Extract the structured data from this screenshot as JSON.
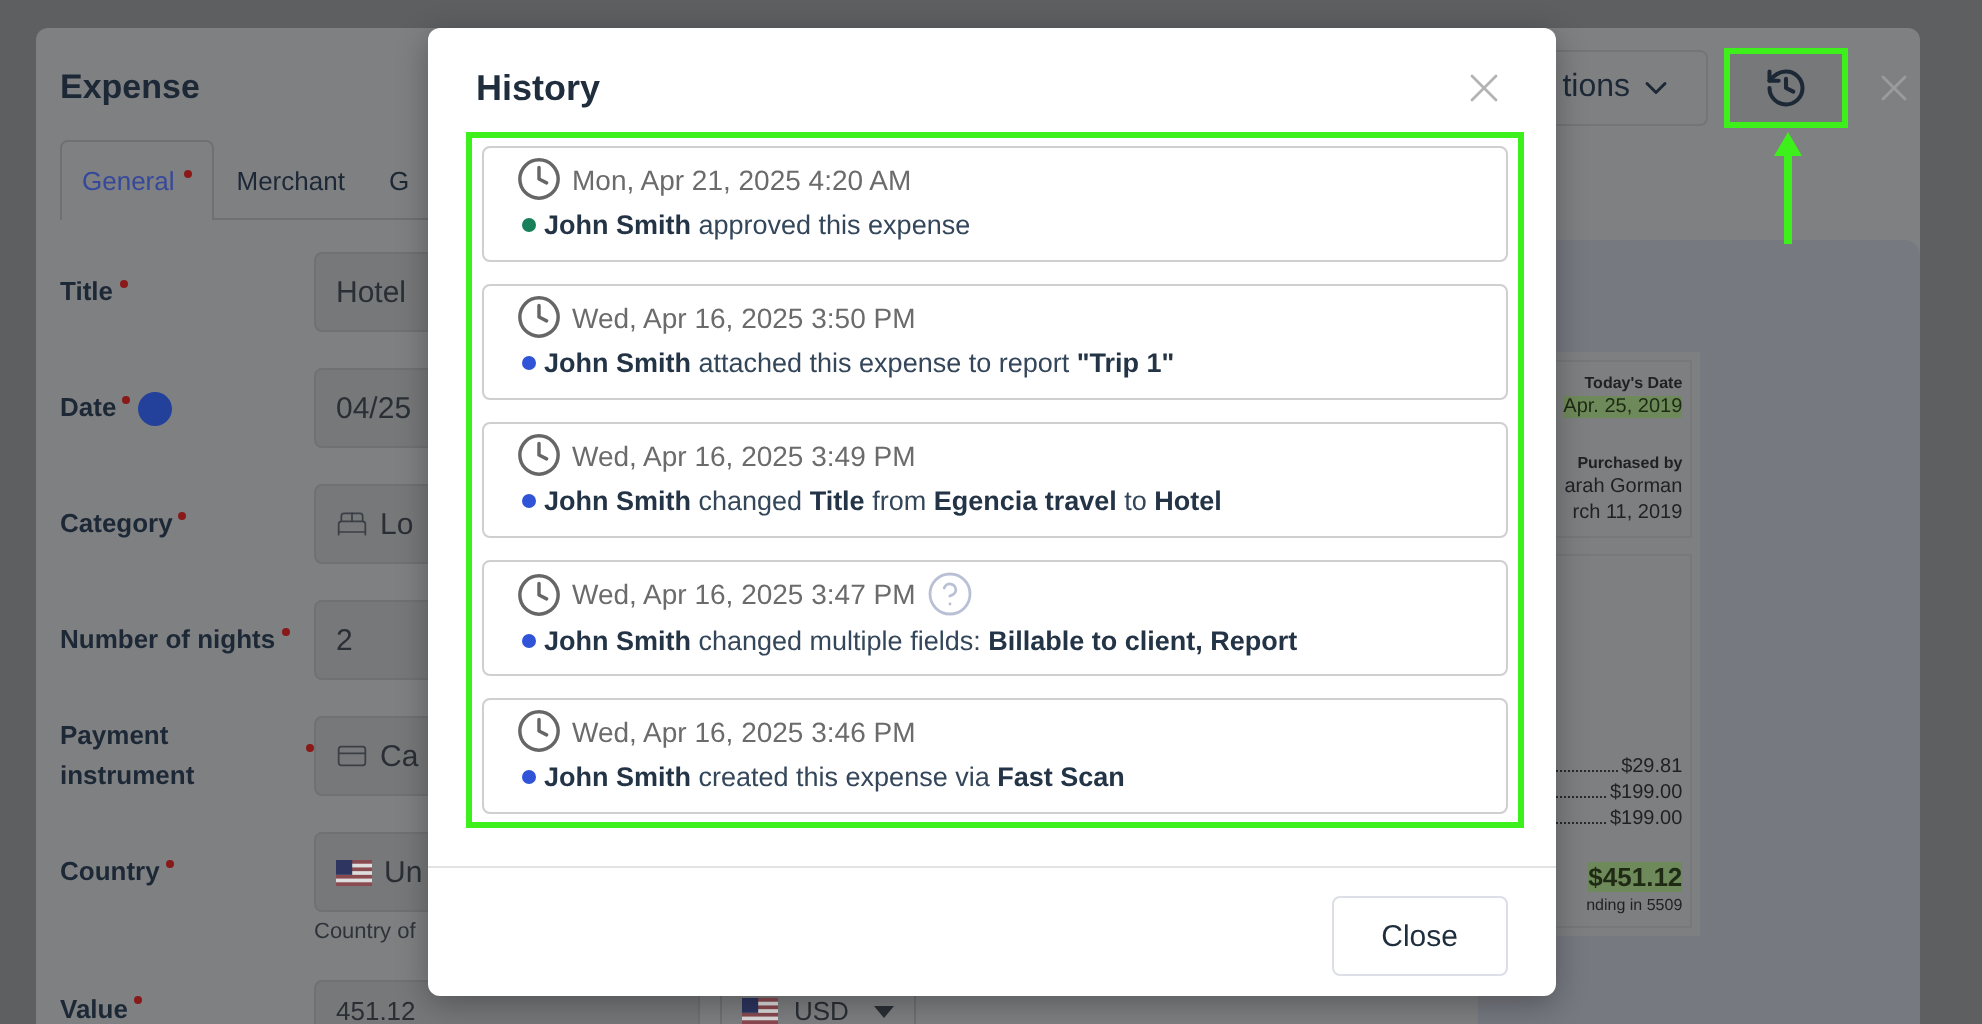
{
  "page": {
    "title": "Expense",
    "tabs": [
      {
        "label": "General",
        "required": true,
        "selected": true
      },
      {
        "label": "Merchant",
        "required": false,
        "selected": false
      },
      {
        "label": "G",
        "required": false,
        "selected": false
      }
    ],
    "options_button": {
      "label": "tions"
    },
    "fields": [
      {
        "label": "Title",
        "required": true,
        "help": false,
        "value": "Hotel",
        "kind": "text"
      },
      {
        "label": "Date",
        "required": true,
        "help": true,
        "value": "04/25",
        "kind": "text"
      },
      {
        "label": "Category",
        "required": true,
        "help": false,
        "value": "Lo",
        "kind": "category"
      },
      {
        "label": "Number of nights",
        "required": true,
        "help": false,
        "value": "2",
        "kind": "text"
      },
      {
        "label": "Payment instrument",
        "required": true,
        "help": false,
        "value": "Ca",
        "kind": "payment"
      },
      {
        "label": "Country",
        "required": true,
        "help": false,
        "value": "Un",
        "kind": "country",
        "hint": "Country of"
      },
      {
        "label": "Value",
        "required": true,
        "help": false,
        "value": "451.12",
        "kind": "amount",
        "currency": "USD"
      }
    ],
    "receipt": {
      "date_label": "Today's Date",
      "date": "Apr. 25, 2019",
      "purchased_label": "Purchased by",
      "purchaser": "arah Gorman",
      "purchase_date": "rch 11, 2019",
      "amounts": [
        "$29.81",
        "$199.00",
        "$199.00"
      ],
      "total": "$451.12",
      "card_note": "nding in 5509"
    }
  },
  "history": {
    "title": "History",
    "entries": [
      {
        "time": "Mon, Apr 21, 2025 4:20 AM",
        "text": "**John Smith** approved this expense",
        "color": "#17805a",
        "help": false
      },
      {
        "time": "Wed, Apr 16, 2025 3:50 PM",
        "text": "**John Smith** attached this expense to report **\"Trip 1\"**",
        "color": "#2f54d8",
        "help": false
      },
      {
        "time": "Wed, Apr 16, 2025 3:49 PM",
        "text": "**John Smith** changed **Title** from **Egencia travel** to **Hotel**",
        "color": "#2f54d8",
        "help": false
      },
      {
        "time": "Wed, Apr 16, 2025 3:47 PM",
        "text": "**John Smith** changed multiple fields: **Billable to client, Report**",
        "color": "#2f54d8",
        "help": true
      },
      {
        "time": "Wed, Apr 16, 2025 3:46 PM",
        "text": "**John Smith** created this expense via **Fast Scan**",
        "color": "#2f54d8",
        "help": false
      }
    ],
    "close_button": "Close"
  }
}
